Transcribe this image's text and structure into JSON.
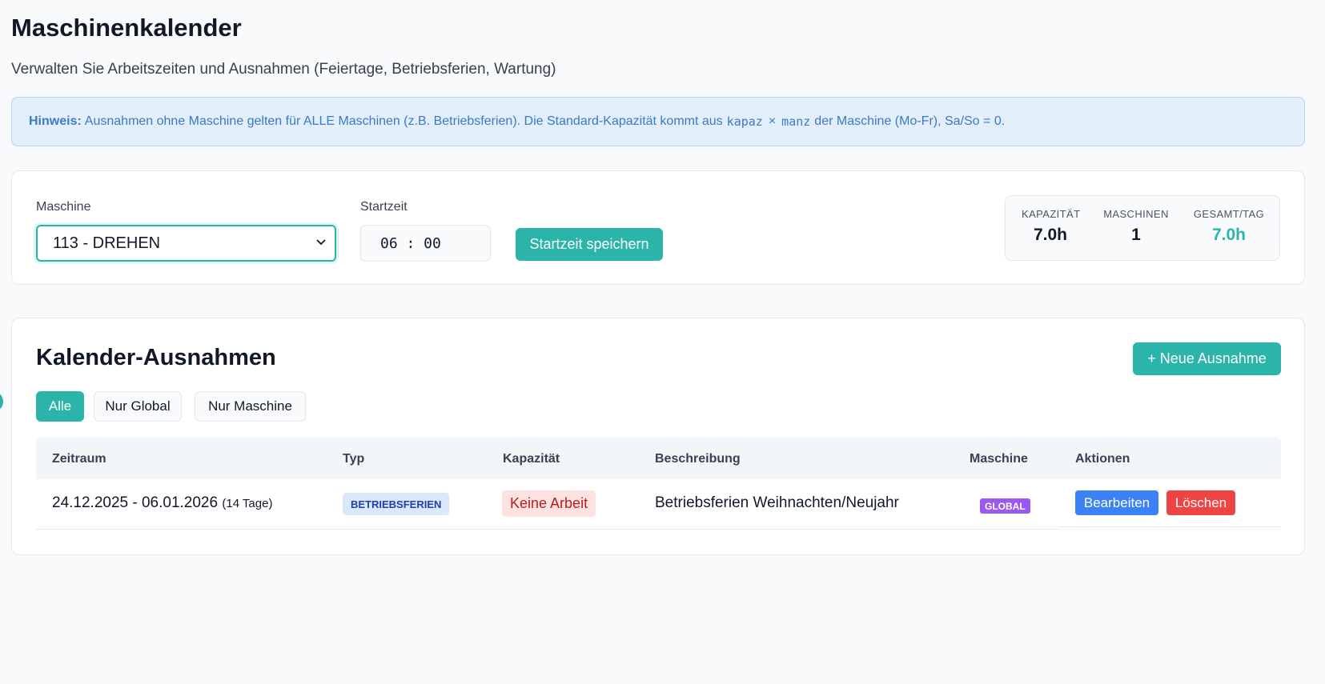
{
  "page": {
    "title": "Maschinenkalender",
    "subtitle": "Verwalten Sie Arbeitszeiten und Ausnahmen (Feiertage, Betriebsferien, Wartung)"
  },
  "hint": {
    "label": "Hinweis:",
    "text_before": "Ausnahmen ohne Maschine gelten für ALLE Maschinen (z.B. Betriebsferien). Die Standard-Kapazität kommt aus",
    "code1": "kapaz",
    "operator": "×",
    "code2": "manz",
    "text_after": "der Maschine (Mo-Fr), Sa/So = 0."
  },
  "settings": {
    "machine_label": "Maschine",
    "machine_value": "113 - DREHEN",
    "start_label": "Startzeit",
    "start_value": "06 : 00",
    "save_button": "Startzeit speichern"
  },
  "stats": {
    "capacity_label": "KAPAZITÄT",
    "capacity_value": "7.0h",
    "machines_label": "MASCHINEN",
    "machines_value": "1",
    "total_label": "GESAMT/TAG",
    "total_value": "7.0h"
  },
  "exceptions": {
    "title": "Kalender-Ausnahmen",
    "new_button": "+ Neue Ausnahme",
    "filters": [
      "Alle",
      "Nur Global",
      "Nur Maschine"
    ],
    "active_filter": "Alle",
    "columns": [
      "Zeitraum",
      "Typ",
      "Kapazität",
      "Beschreibung",
      "Maschine",
      "Aktionen"
    ],
    "rows": [
      {
        "period": "24.12.2025 - 06.01.2026",
        "duration": "(14 Tage)",
        "type": "BETRIEBSFERIEN",
        "capacity": "Keine Arbeit",
        "description": "Betriebsferien Weihnachten/Neujahr",
        "machine": "GLOBAL",
        "edit": "Bearbeiten",
        "delete": "Löschen"
      }
    ]
  },
  "colors": {
    "accent": "#2bb5aa",
    "hint_bg": "#e3eefb",
    "hint_text": "#3b7ac4",
    "edit_button": "#3b82f6",
    "delete_button": "#ef4444",
    "global_badge": "#9b59f0"
  },
  "icons": {
    "select_chevron": "chevron-down-icon"
  }
}
